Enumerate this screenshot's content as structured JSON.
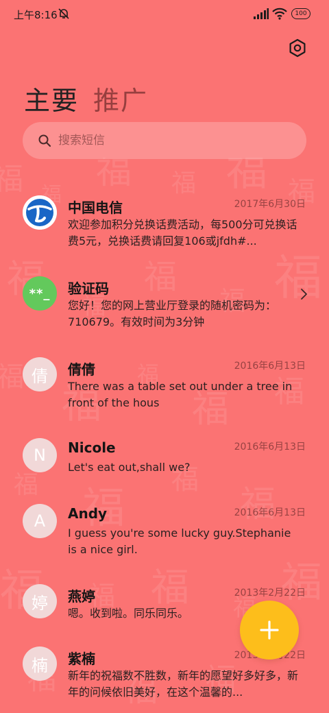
{
  "status_bar": {
    "time": "上午8:16",
    "battery": "100"
  },
  "header": {
    "tab_main": "主要",
    "tab_promo": "推广"
  },
  "search": {
    "placeholder": "搜索短信"
  },
  "messages": [
    {
      "sender": "中国电信",
      "date": "2017年6月30日",
      "preview": "欢迎参加积分兑换话费活动，每500分可兑换话费5元，兑换话费请回复106或jfdh#...",
      "avatar_type": "carrier-logo"
    },
    {
      "sender": "验证码",
      "date": "",
      "preview": "您好！您的网上营业厅登录的随机密码为：710679。有效时间为3分钟",
      "avatar_type": "code",
      "avatar_text": "**_"
    },
    {
      "sender": "倩倩",
      "date": "2016年6月13日",
      "preview": "There was a table set out under a tree in front of the hous",
      "avatar_type": "letter",
      "avatar_text": "倩"
    },
    {
      "sender": "Nicole",
      "date": "2016年6月13日",
      "preview": "Let's eat out,shall we?",
      "avatar_type": "letter",
      "avatar_text": "N"
    },
    {
      "sender": "Andy",
      "date": "2016年6月13日",
      "preview": "I guess you're some lucky guy.Stephanie is a nice girl.",
      "avatar_type": "letter",
      "avatar_text": "A"
    },
    {
      "sender": "燕婷",
      "date": "2013年2月22日",
      "preview": "嗯。收到啦。同乐同乐。",
      "avatar_type": "letter",
      "avatar_text": "婷"
    },
    {
      "sender": "紫楠",
      "date": "2013年2月22日",
      "preview": "新年的祝福数不胜数，新年的愿望好多好多，新年的问候依旧美好，在这个温馨的...",
      "avatar_type": "letter",
      "avatar_text": "楠"
    }
  ],
  "colors": {
    "background": "#fb7373",
    "fab": "#fdbe1b",
    "code_avatar": "#63c95c",
    "carrier_blue": "#1a66c6"
  },
  "icons": {
    "settings": "gear-hexagon-icon",
    "search": "search-icon",
    "fab": "plus-icon",
    "chevron": "chevron-right-icon"
  }
}
